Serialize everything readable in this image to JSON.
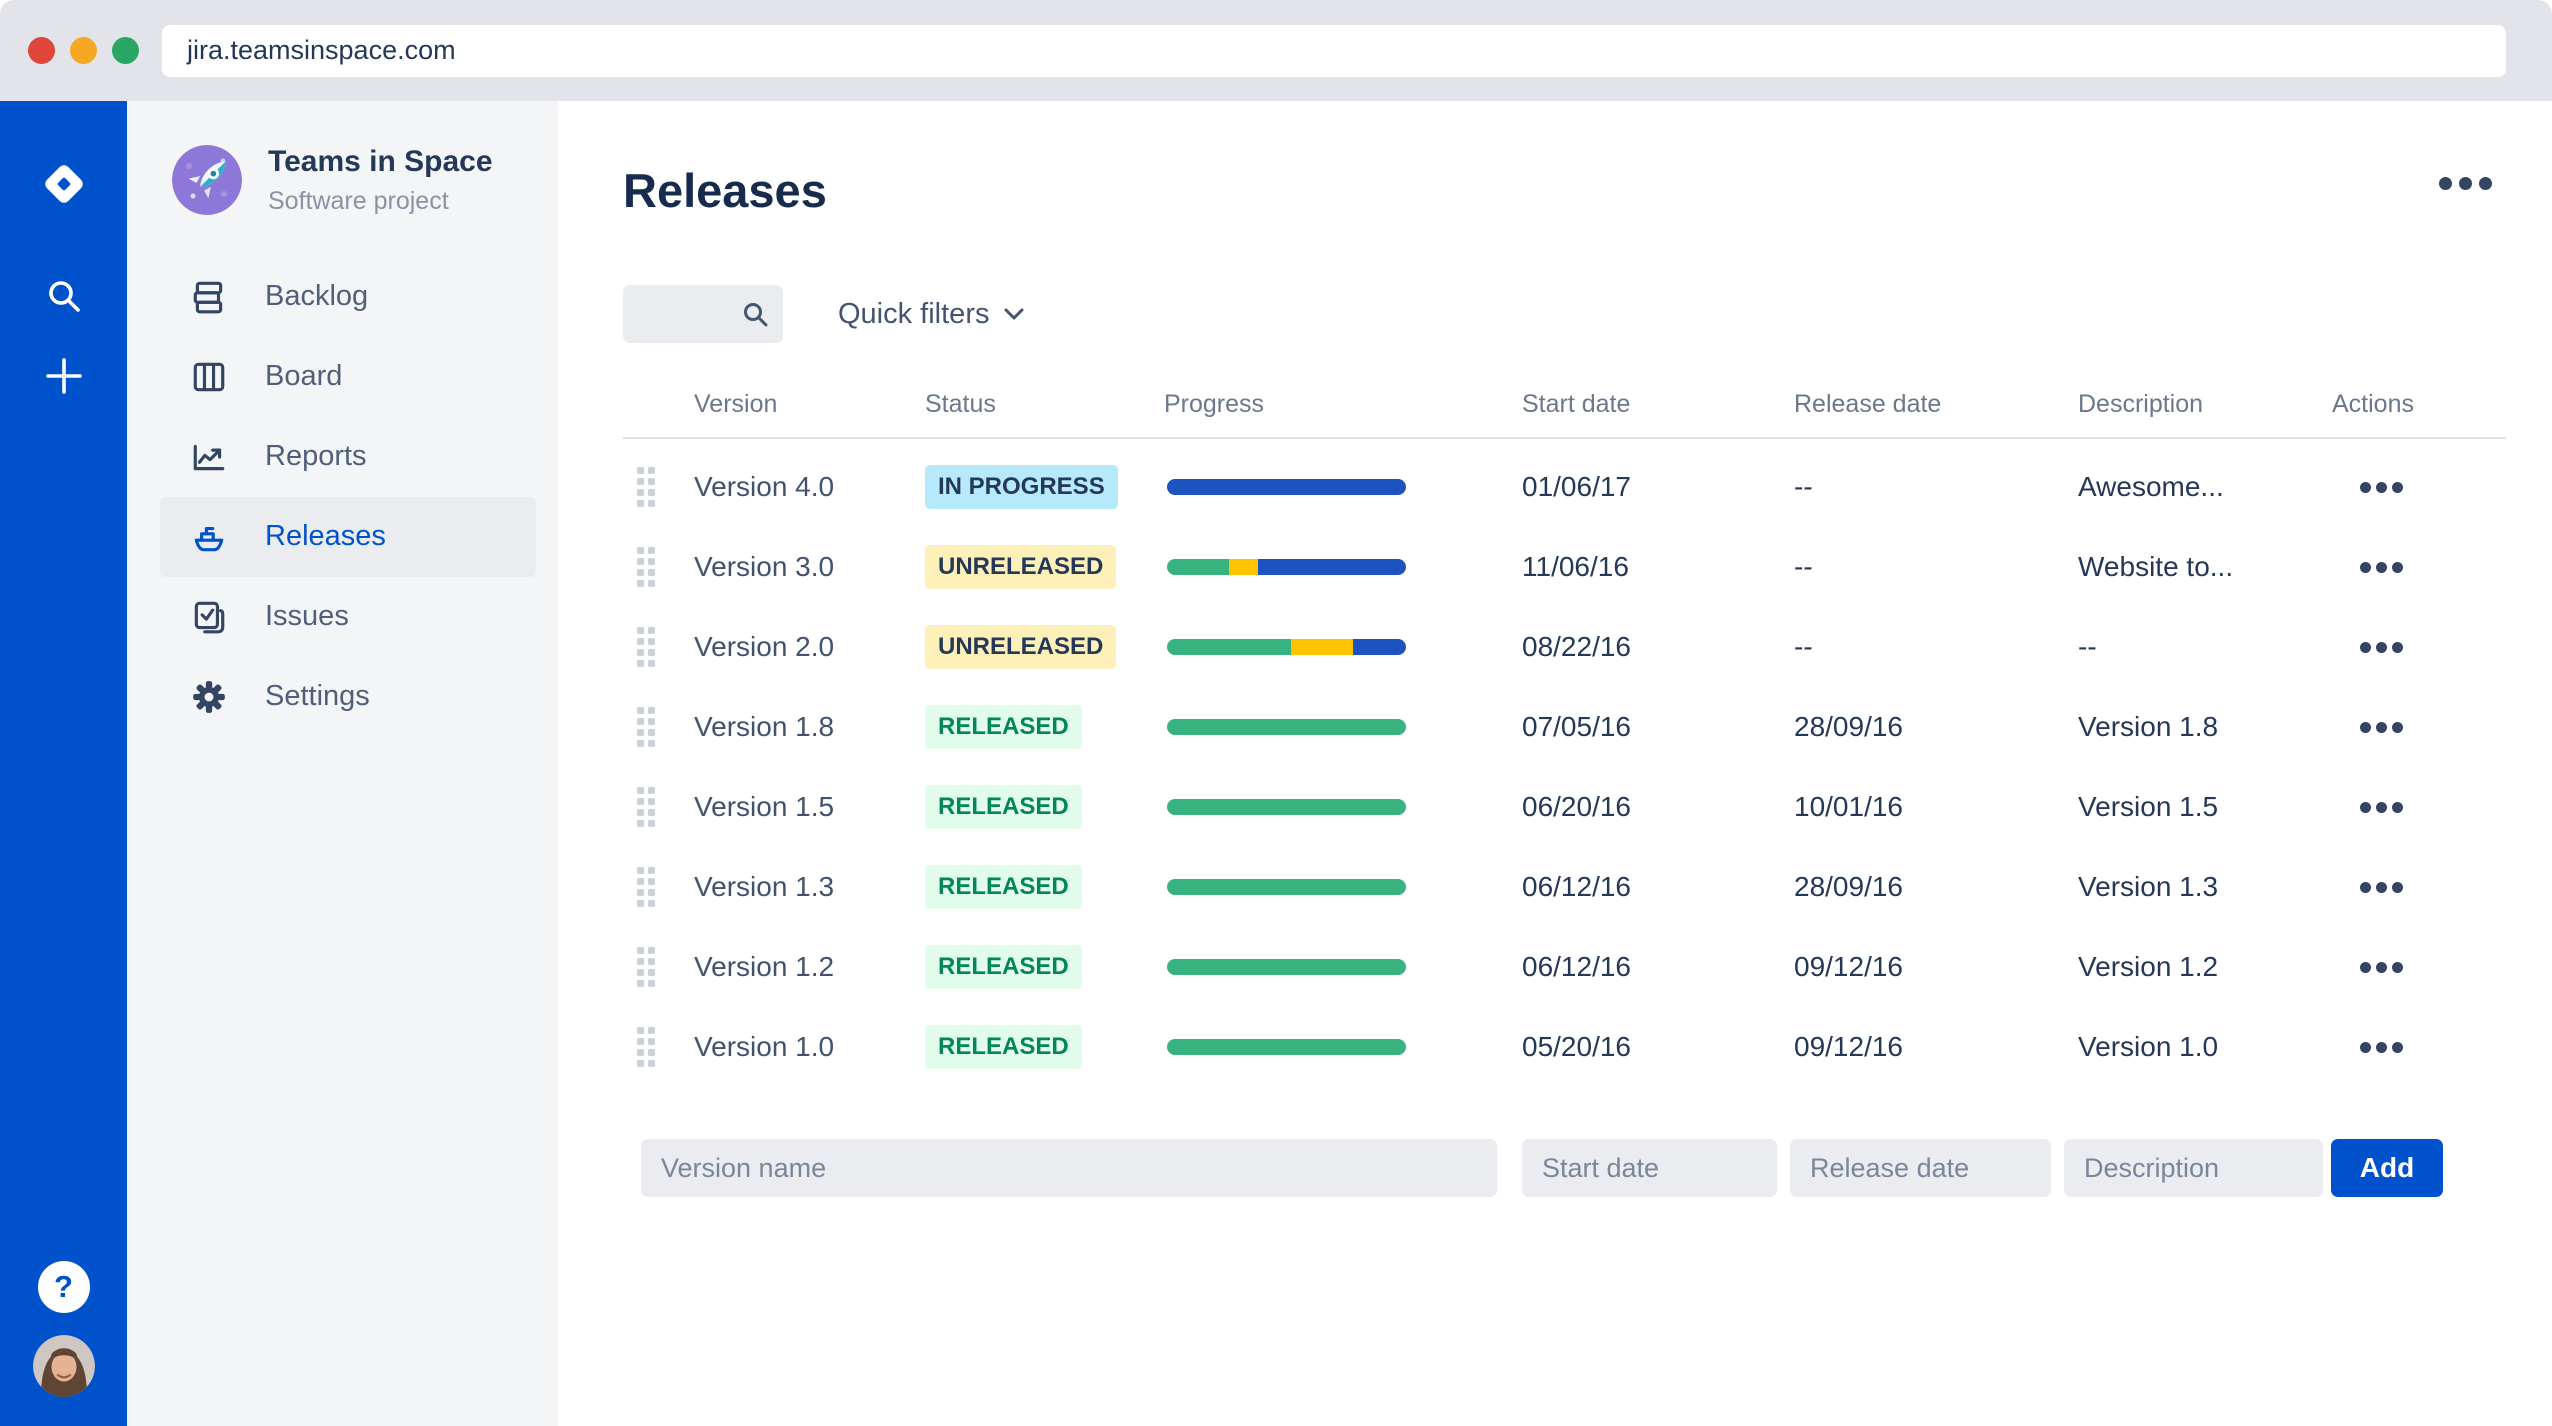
{
  "browser": {
    "url": "jira.teamsinspace.com",
    "traffic_lights": [
      "#e0443a",
      "#f6a723",
      "#29a664"
    ]
  },
  "rail": {
    "help_label": "?"
  },
  "project": {
    "name": "Teams in Space",
    "type": "Software project"
  },
  "nav": {
    "items": [
      {
        "label": "Backlog"
      },
      {
        "label": "Board"
      },
      {
        "label": "Reports"
      },
      {
        "label": "Releases",
        "selected": true
      },
      {
        "label": "Issues"
      },
      {
        "label": "Settings"
      }
    ]
  },
  "page": {
    "title": "Releases"
  },
  "filters": {
    "search_value": "",
    "quick_filters_label": "Quick filters"
  },
  "table": {
    "columns": [
      "Version",
      "Status",
      "Progress",
      "Start date",
      "Release date",
      "Description",
      "Actions"
    ],
    "rows": [
      {
        "version": "Version 4.0",
        "status": "IN PROGRESS",
        "status_type": "inprogress",
        "progress": {
          "green": 0,
          "yellow": 0,
          "blue": 100
        },
        "start_date": "01/06/17",
        "release_date": "--",
        "description": "Awesome..."
      },
      {
        "version": "Version 3.0",
        "status": "UNRELEASED",
        "status_type": "unreleased",
        "progress": {
          "green": 26,
          "yellow": 12,
          "blue": 62
        },
        "start_date": "11/06/16",
        "release_date": "--",
        "description": "Website to..."
      },
      {
        "version": "Version 2.0",
        "status": "UNRELEASED",
        "status_type": "unreleased",
        "progress": {
          "green": 52,
          "yellow": 26,
          "blue": 22
        },
        "start_date": "08/22/16",
        "release_date": "--",
        "description": "--"
      },
      {
        "version": "Version 1.8",
        "status": "RELEASED",
        "status_type": "released",
        "progress": {
          "green": 100,
          "yellow": 0,
          "blue": 0
        },
        "start_date": "07/05/16",
        "release_date": "28/09/16",
        "description": "Version 1.8"
      },
      {
        "version": "Version 1.5",
        "status": "RELEASED",
        "status_type": "released",
        "progress": {
          "green": 100,
          "yellow": 0,
          "blue": 0
        },
        "start_date": "06/20/16",
        "release_date": "10/01/16",
        "description": "Version 1.5"
      },
      {
        "version": "Version 1.3",
        "status": "RELEASED",
        "status_type": "released",
        "progress": {
          "green": 100,
          "yellow": 0,
          "blue": 0
        },
        "start_date": "06/12/16",
        "release_date": "28/09/16",
        "description": "Version 1.3"
      },
      {
        "version": "Version 1.2",
        "status": "RELEASED",
        "status_type": "released",
        "progress": {
          "green": 100,
          "yellow": 0,
          "blue": 0
        },
        "start_date": "06/12/16",
        "release_date": "09/12/16",
        "description": "Version 1.2"
      },
      {
        "version": "Version 1.0",
        "status": "RELEASED",
        "status_type": "released",
        "progress": {
          "green": 100,
          "yellow": 0,
          "blue": 0
        },
        "start_date": "05/20/16",
        "release_date": "09/12/16",
        "description": "Version 1.0"
      }
    ]
  },
  "form": {
    "version_placeholder": "Version name",
    "start_placeholder": "Start date",
    "release_placeholder": "Release date",
    "description_placeholder": "Description",
    "add_label": "Add"
  },
  "colors": {
    "accent": "#0052CC",
    "progress_blue": "#1D53C1",
    "progress_green": "#36B37E",
    "progress_yellow": "#FFC400",
    "badge_inprogress_bg": "#B5E9FB",
    "badge_unreleased_bg": "#FDF0B8",
    "badge_released_bg": "#E2FCEC",
    "badge_released_text": "#00875A"
  }
}
